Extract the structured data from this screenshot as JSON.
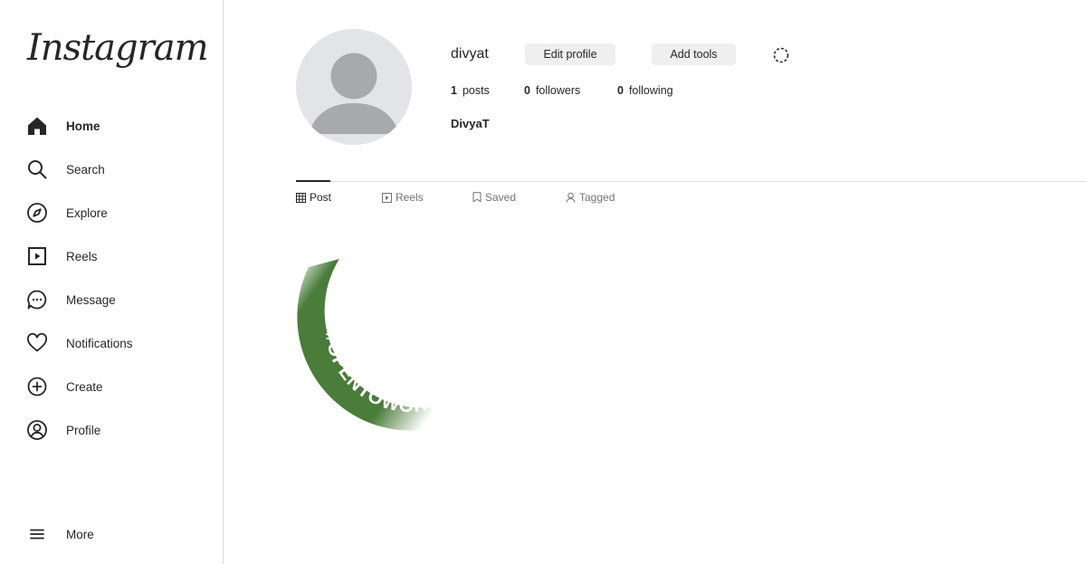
{
  "app": {
    "logo": "Instagram"
  },
  "sidebar": {
    "items": [
      {
        "label": "Home",
        "icon": "home-icon"
      },
      {
        "label": "Search",
        "icon": "search-icon"
      },
      {
        "label": "Explore",
        "icon": "compass-icon"
      },
      {
        "label": "Reels",
        "icon": "reels-icon"
      },
      {
        "label": "Message",
        "icon": "message-icon"
      },
      {
        "label": "Notifications",
        "icon": "heart-icon"
      },
      {
        "label": "Create",
        "icon": "plus-circle-icon"
      },
      {
        "label": "Profile",
        "icon": "profile-icon"
      }
    ],
    "more": {
      "label": "More",
      "icon": "menu-icon"
    }
  },
  "profile": {
    "username": "divyat",
    "edit_label": "Edit profile",
    "tools_label": "Add tools",
    "stats": {
      "posts": {
        "count": "1",
        "label": "posts"
      },
      "followers": {
        "count": "0",
        "label": "followers"
      },
      "following": {
        "count": "0",
        "label": "following"
      }
    },
    "full_name": "DivyaT"
  },
  "tabs": [
    {
      "label": "Post",
      "icon": "grid-icon",
      "active": true
    },
    {
      "label": "Reels",
      "icon": "reels-icon",
      "active": false
    },
    {
      "label": "Saved",
      "icon": "bookmark-icon",
      "active": false
    },
    {
      "label": "Tagged",
      "icon": "tagged-user-icon",
      "active": false
    }
  ],
  "posts": [
    {
      "text": "#OPENTOWORK",
      "color": "#4a7c3a"
    }
  ]
}
